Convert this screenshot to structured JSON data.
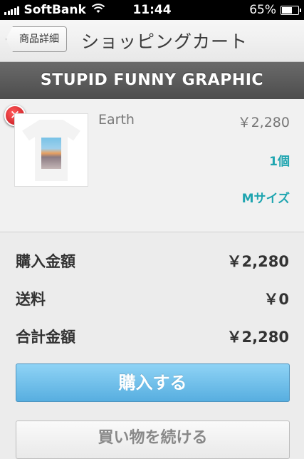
{
  "status_bar": {
    "carrier": "SoftBank",
    "time": "11:44",
    "battery_text": "65%",
    "battery_level": 0.65
  },
  "nav": {
    "back_label": "商品詳細",
    "title": "ショッピングカート"
  },
  "shop": {
    "name": "STUPID FUNNY GRAPHIC"
  },
  "item": {
    "name": "Earth",
    "price": "￥2,280",
    "quantity": "1個",
    "size": "Mサイズ",
    "remove_icon": "close-icon",
    "remove_color": "#d7161e"
  },
  "summary": {
    "subtotal_label": "購入金額",
    "subtotal_value": "￥2,280",
    "shipping_label": "送料",
    "shipping_value": "￥0",
    "total_label": "合計金額",
    "total_value": "￥2,280"
  },
  "actions": {
    "buy_label": "購入する",
    "continue_label": "買い物を続ける"
  },
  "colors": {
    "accent": "#1fa5b0",
    "buy_button": "#6cc0ea",
    "header_bar": "#555555"
  }
}
